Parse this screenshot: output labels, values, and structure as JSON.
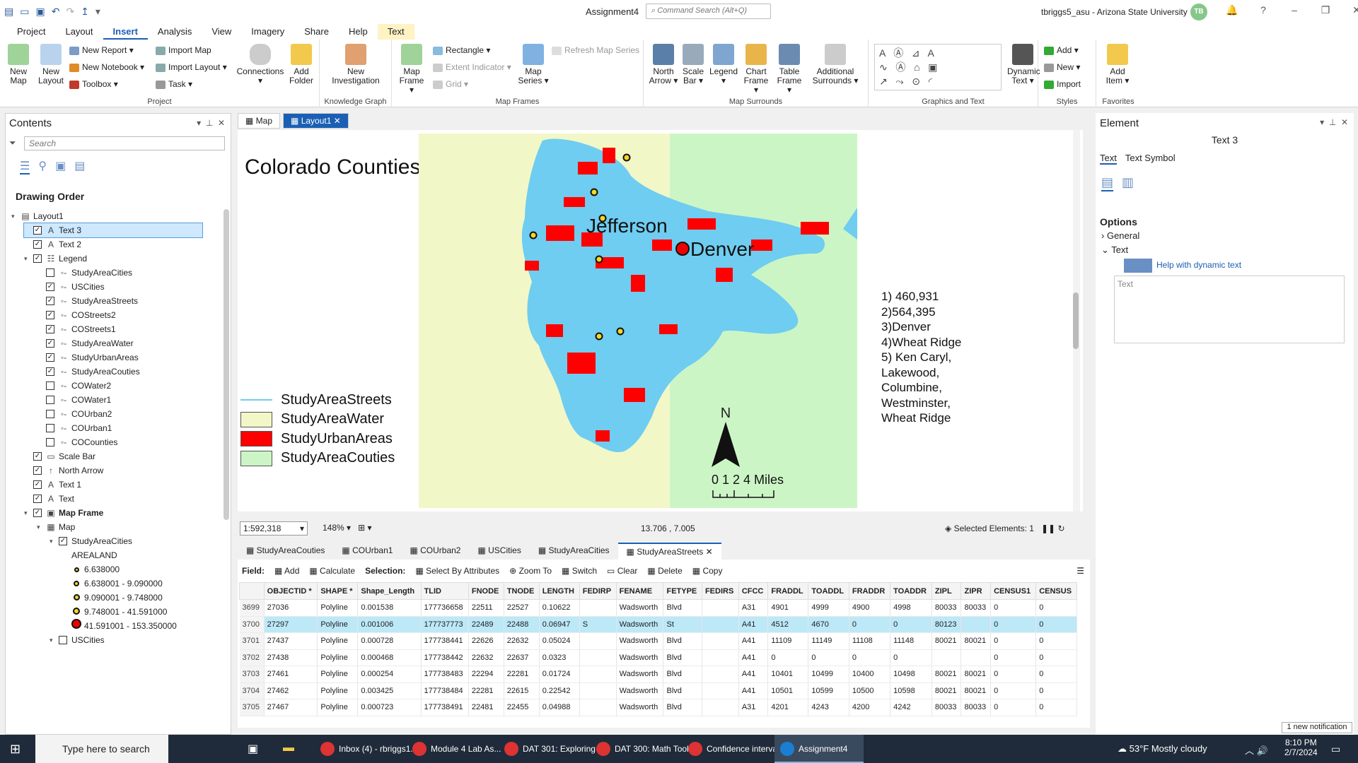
{
  "title_bar": {
    "quick_access_icons": [
      "new-project-icon",
      "open-icon",
      "save-icon",
      "undo-icon",
      "redo-icon",
      "select-icon"
    ],
    "doc_title": "Assignment4",
    "search_placeholder": "Command Search (Alt+Q)",
    "user": "tbriggs5_asu - Arizona State University",
    "avatar": "TB"
  },
  "menu_tabs": [
    "Project",
    "Layout",
    "Insert",
    "Analysis",
    "View",
    "Imagery",
    "Share",
    "Help",
    "Text"
  ],
  "ribbon": {
    "project_group": {
      "label": "Project",
      "new_map": "New Map",
      "new_layout": "New Layout",
      "new_report": "New Report",
      "new_notebook": "New Notebook",
      "toolbox": "Toolbox",
      "import_map": "Import Map",
      "import_layout": "Import Layout",
      "task": "Task",
      "connections": "Connections",
      "add_folder": "Add Folder"
    },
    "kg_group": {
      "label": "Knowledge Graph",
      "new_investigation": "New Investigation"
    },
    "mapframes_group": {
      "label": "Map Frames",
      "map_frame": "Map Frame",
      "rectangle": "Rectangle",
      "extent_indicator": "Extent Indicator",
      "grid": "Grid",
      "map_series": "Map Series",
      "refresh": "Refresh Map Series"
    },
    "surrounds_group": {
      "label": "Map Surrounds",
      "north_arrow": "North Arrow",
      "scale_bar": "Scale Bar",
      "legend": "Legend",
      "chart_frame": "Chart Frame",
      "table_frame": "Table Frame",
      "additional": "Additional Surrounds"
    },
    "graphics_group": {
      "label": "Graphics and Text",
      "dynamic_text": "Dynamic Text"
    },
    "styles_group": {
      "label": "Styles",
      "add": "Add",
      "new": "New",
      "import": "Import"
    },
    "favorites_group": {
      "label": "Favorites",
      "add_item": "Add Item"
    }
  },
  "contents": {
    "title": "Contents",
    "search_placeholder": "Search",
    "drawing_order": "Drawing Order",
    "items": [
      {
        "label": "Layout1",
        "indent": 0,
        "check": null,
        "icon": "layout-icon",
        "expand": "▾"
      },
      {
        "label": "Text 3",
        "indent": 1,
        "check": true,
        "icon": "text-icon",
        "selected": true
      },
      {
        "label": "Text 2",
        "indent": 1,
        "check": true,
        "icon": "text-icon"
      },
      {
        "label": "Legend",
        "indent": 1,
        "check": true,
        "icon": "legend-icon",
        "expand": "▾"
      },
      {
        "label": "StudyAreaCities",
        "indent": 2,
        "check": false,
        "icon": "legend-item-icon"
      },
      {
        "label": "USCities",
        "indent": 2,
        "check": true,
        "icon": "legend-item-icon"
      },
      {
        "label": "StudyAreaStreets",
        "indent": 2,
        "check": true,
        "icon": "legend-item-icon"
      },
      {
        "label": "COStreets2",
        "indent": 2,
        "check": true,
        "icon": "legend-item-icon"
      },
      {
        "label": "COStreets1",
        "indent": 2,
        "check": true,
        "icon": "legend-item-icon"
      },
      {
        "label": "StudyAreaWater",
        "indent": 2,
        "check": true,
        "icon": "legend-item-icon"
      },
      {
        "label": "StudyUrbanAreas",
        "indent": 2,
        "check": true,
        "icon": "legend-item-icon"
      },
      {
        "label": "StudyAreaCouties",
        "indent": 2,
        "check": true,
        "icon": "legend-item-icon"
      },
      {
        "label": "COWater2",
        "indent": 2,
        "check": false,
        "icon": "legend-item-icon"
      },
      {
        "label": "COWater1",
        "indent": 2,
        "check": false,
        "icon": "legend-item-icon"
      },
      {
        "label": "COUrban2",
        "indent": 2,
        "check": false,
        "icon": "legend-item-icon"
      },
      {
        "label": "COUrban1",
        "indent": 2,
        "check": false,
        "icon": "legend-item-icon"
      },
      {
        "label": "COCounties",
        "indent": 2,
        "check": false,
        "icon": "legend-item-icon"
      },
      {
        "label": "Scale Bar",
        "indent": 1,
        "check": true,
        "icon": "scale-bar-icon"
      },
      {
        "label": "North Arrow",
        "indent": 1,
        "check": true,
        "icon": "north-arrow-icon"
      },
      {
        "label": "Text 1",
        "indent": 1,
        "check": true,
        "icon": "text-icon"
      },
      {
        "label": "Text",
        "indent": 1,
        "check": true,
        "icon": "text-icon"
      },
      {
        "label": "Map Frame",
        "indent": 1,
        "check": true,
        "icon": "map-frame-icon",
        "expand": "▾",
        "bold": true
      },
      {
        "label": "Map",
        "indent": 2,
        "check": null,
        "icon": "map-icon",
        "expand": "▾"
      },
      {
        "label": "StudyAreaCities",
        "indent": 3,
        "check": true,
        "icon": null,
        "expand": "▾"
      },
      {
        "label": "AREALAND",
        "indent": 4,
        "check": null,
        "icon": null
      },
      {
        "label": "6.638000",
        "indent": 4,
        "check": null,
        "icon": "dot-xs"
      },
      {
        "label": "6.638001 - 9.090000",
        "indent": 4,
        "check": null,
        "icon": "dot-s"
      },
      {
        "label": "9.090001 - 9.748000",
        "indent": 4,
        "check": null,
        "icon": "dot-m"
      },
      {
        "label": "9.748001 - 41.591000",
        "indent": 4,
        "check": null,
        "icon": "dot-l"
      },
      {
        "label": "41.591001 - 153.350000",
        "indent": 4,
        "check": null,
        "icon": "dot-xl"
      },
      {
        "label": "USCities",
        "indent": 3,
        "check": false,
        "icon": null,
        "expand": "▾"
      }
    ]
  },
  "view_tabs": [
    {
      "label": "Map",
      "active": false
    },
    {
      "label": "Layout1",
      "active": true
    }
  ],
  "layout": {
    "title": "Colorado Counties",
    "labels": {
      "jefferson": "Jefferson",
      "denver": "Denver"
    },
    "answers": [
      "1) 460,931",
      "2)564,395",
      "3)Denver",
      "4)Wheat Ridge",
      "5) Ken Caryl,",
      "Lakewood,",
      "Columbine,",
      "Westminster,",
      "Wheat Ridge"
    ],
    "north": "N",
    "scale_text": "0 1 2    4 Miles",
    "legend": [
      {
        "label": "StudyAreaStreets",
        "type": "line",
        "color": "#6ecdf0"
      },
      {
        "label": "StudyAreaWater",
        "type": "fill",
        "color": "#f2f7c8"
      },
      {
        "label": "StudyUrbanAreas",
        "type": "fill",
        "color": "#ff0000"
      },
      {
        "label": "StudyAreaCouties",
        "type": "fill",
        "color": "#ccf5c6"
      }
    ]
  },
  "status": {
    "scale": "1:592,318",
    "zoom": "148%",
    "coords": "13.706 , 7.005",
    "selected": "Selected Elements: 1"
  },
  "attr_tabs": [
    {
      "label": "StudyAreaCouties",
      "active": false
    },
    {
      "label": "COUrban1",
      "active": false
    },
    {
      "label": "COUrban2",
      "active": false
    },
    {
      "label": "USCities",
      "active": false
    },
    {
      "label": "StudyAreaCities",
      "active": false
    },
    {
      "label": "StudyAreaStreets",
      "active": true
    }
  ],
  "attr_toolbar": {
    "field": "Field:",
    "add": "Add",
    "calculate": "Calculate",
    "selection": "Selection:",
    "select_by_attributes": "Select By Attributes",
    "zoom_to": "Zoom To",
    "switch": "Switch",
    "clear": "Clear",
    "delete": "Delete",
    "copy": "Copy"
  },
  "table": {
    "columns": [
      "",
      "OBJECTID *",
      "SHAPE *",
      "Shape_Length",
      "TLID",
      "FNODE",
      "TNODE",
      "LENGTH",
      "FEDIRP",
      "FENAME",
      "FETYPE",
      "FEDIRS",
      "CFCC",
      "FRADDL",
      "TOADDL",
      "FRADDR",
      "TOADDR",
      "ZIPL",
      "ZIPR",
      "CENSUS1",
      "CENSUS"
    ],
    "rows": [
      [
        "3699",
        "27036",
        "Polyline",
        "0.001538",
        "177736658",
        "22511",
        "22527",
        "0.10622",
        "",
        "Wadsworth",
        "Blvd",
        "",
        "A31",
        "4901",
        "4999",
        "4900",
        "4998",
        "80033",
        "80033",
        "0",
        "0"
      ],
      [
        "3700",
        "27297",
        "Polyline",
        "0.001006",
        "177737773",
        "22489",
        "22488",
        "0.06947",
        "S",
        "Wadsworth",
        "St",
        "",
        "A41",
        "4512",
        "4670",
        "0",
        "0",
        "80123",
        "",
        "0",
        "0"
      ],
      [
        "3701",
        "27437",
        "Polyline",
        "0.000728",
        "177738441",
        "22626",
        "22632",
        "0.05024",
        "",
        "Wadsworth",
        "Blvd",
        "",
        "A41",
        "11109",
        "11149",
        "11108",
        "11148",
        "80021",
        "80021",
        "0",
        "0"
      ],
      [
        "3702",
        "27438",
        "Polyline",
        "0.000468",
        "177738442",
        "22632",
        "22637",
        "0.0323",
        "",
        "Wadsworth",
        "Blvd",
        "",
        "A41",
        "0",
        "0",
        "0",
        "0",
        "",
        "",
        "0",
        "0"
      ],
      [
        "3703",
        "27461",
        "Polyline",
        "0.000254",
        "177738483",
        "22294",
        "22281",
        "0.01724",
        "",
        "Wadsworth",
        "Blvd",
        "",
        "A41",
        "10401",
        "10499",
        "10400",
        "10498",
        "80021",
        "80021",
        "0",
        "0"
      ],
      [
        "3704",
        "27462",
        "Polyline",
        "0.003425",
        "177738484",
        "22281",
        "22615",
        "0.22542",
        "",
        "Wadsworth",
        "Blvd",
        "",
        "A41",
        "10501",
        "10599",
        "10500",
        "10598",
        "80021",
        "80021",
        "0",
        "0"
      ],
      [
        "3705",
        "27467",
        "Polyline",
        "0.000723",
        "177738491",
        "22481",
        "22455",
        "0.04988",
        "",
        "Wadsworth",
        "Blvd",
        "",
        "A31",
        "4201",
        "4243",
        "4200",
        "4242",
        "80033",
        "80033",
        "0",
        "0"
      ]
    ],
    "selected_row": 1
  },
  "element_pane": {
    "title": "Element",
    "subtitle": "Text 3",
    "tabs": [
      "Text",
      "Text Symbol"
    ],
    "options": "Options",
    "general": "General",
    "text": "Text",
    "help": "Help with dynamic text",
    "text_placeholder": "Text"
  },
  "notification": "1 new notification",
  "taskbar": {
    "search": "Type here to search",
    "apps": [
      "Inbox (4) - rbriggs1...",
      "Module 4 Lab As...",
      "DAT 301: Exploring ...",
      "DAT 300: Math Tool...",
      "Confidence interval...",
      "Assignment4"
    ],
    "weather": "53°F  Mostly cloudy",
    "time": "8:10 PM",
    "date": "2/7/2024"
  }
}
